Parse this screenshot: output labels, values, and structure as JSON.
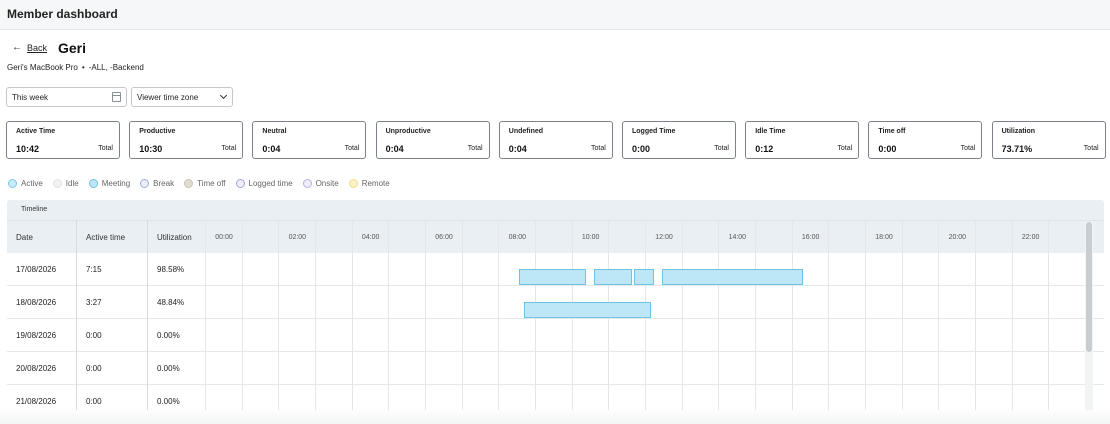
{
  "topbar": {
    "title": "Member dashboard"
  },
  "header": {
    "back_label": "Back",
    "member_name": "Geri",
    "device": "Geri's MacBook Pro",
    "separator": "•",
    "groups": "-ALL, -Backend"
  },
  "filters": {
    "date_range": "This week",
    "timezone": "Viewer time zone"
  },
  "stats": [
    {
      "label": "Active Time",
      "value": "10:42",
      "suffix": "Total"
    },
    {
      "label": "Productive",
      "value": "10:30",
      "suffix": "Total"
    },
    {
      "label": "Neutral",
      "value": "0:04",
      "suffix": "Total"
    },
    {
      "label": "Unproductive",
      "value": "0:04",
      "suffix": "Total"
    },
    {
      "label": "Undefined",
      "value": "0:04",
      "suffix": "Total"
    },
    {
      "label": "Logged Time",
      "value": "0:00",
      "suffix": "Total"
    },
    {
      "label": "Idle Time",
      "value": "0:12",
      "suffix": "Total"
    },
    {
      "label": "Time off",
      "value": "0:00",
      "suffix": "Total"
    },
    {
      "label": "Utilization",
      "value": "73.71%",
      "suffix": "Total"
    }
  ],
  "legend": [
    {
      "label": "Active",
      "fill": "#c9ecf8",
      "stroke": "#7ccbe6"
    },
    {
      "label": "Idle",
      "fill": "#f1f2f3",
      "stroke": "#e0e2e5"
    },
    {
      "label": "Meeting",
      "fill": "#bfe6f6",
      "stroke": "#6fc0e0"
    },
    {
      "label": "Break",
      "fill": "#eceefa",
      "stroke": "#a7abd8"
    },
    {
      "label": "Time off",
      "fill": "#e0ddd2",
      "stroke": "#c6c2b2"
    },
    {
      "label": "Logged time",
      "fill": "#ededf8",
      "stroke": "#a3a7d6"
    },
    {
      "label": "Onsite",
      "fill": "#f0eefa",
      "stroke": "#b4b0e2"
    },
    {
      "label": "Remote",
      "fill": "#fbf2c8",
      "stroke": "#f0de8a"
    }
  ],
  "timeline": {
    "title": "Timeline",
    "columns": {
      "date": "Date",
      "active": "Active time",
      "utilization": "Utilization"
    },
    "ticks": [
      "00:00",
      "02:00",
      "04:00",
      "06:00",
      "08:00",
      "10:00",
      "12:00",
      "14:00",
      "16:00",
      "18:00",
      "20:00",
      "22:00"
    ],
    "rows": [
      {
        "date": "17/08/2026",
        "active": "7:15",
        "utilization": "98.58%",
        "segments": [
          {
            "start": 8.55,
            "end": 10.4
          },
          {
            "start": 10.6,
            "end": 11.65
          },
          {
            "start": 11.7,
            "end": 12.25
          },
          {
            "start": 12.45,
            "end": 16.3
          }
        ]
      },
      {
        "date": "18/08/2026",
        "active": "3:27",
        "utilization": "48.84%",
        "segments": [
          {
            "start": 8.7,
            "end": 12.15
          }
        ]
      },
      {
        "date": "19/08/2026",
        "active": "0:00",
        "utilization": "0.00%",
        "segments": []
      },
      {
        "date": "20/08/2026",
        "active": "0:00",
        "utilization": "0.00%",
        "segments": []
      },
      {
        "date": "21/08/2026",
        "active": "0:00",
        "utilization": "0.00%",
        "segments": []
      }
    ]
  }
}
